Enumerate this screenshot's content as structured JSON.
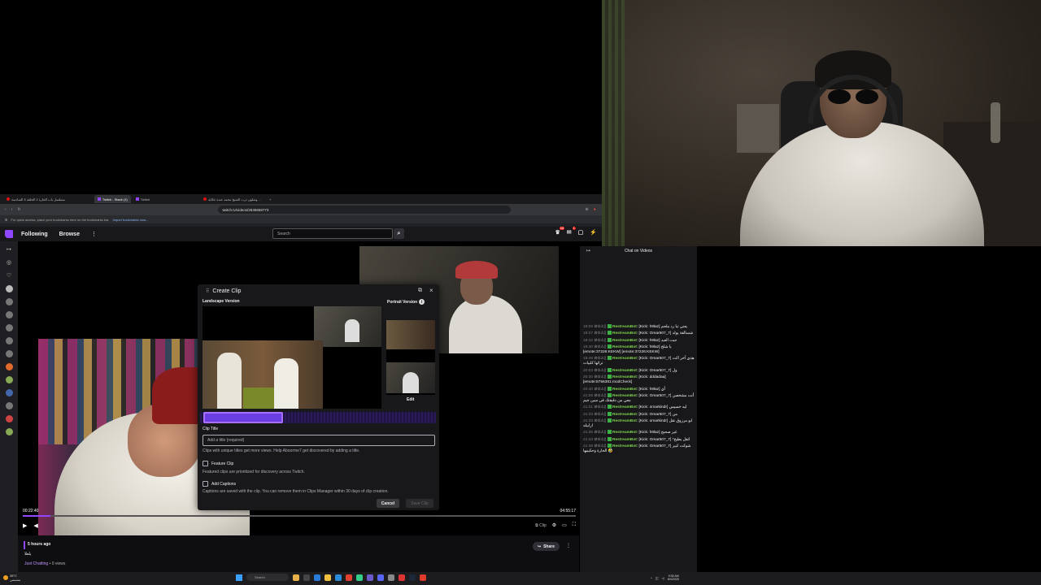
{
  "browser": {
    "tabs": [
      {
        "label": "مسلسل باب الحارة 2 الحلقة 5 السادسة",
        "active": false
      },
      {
        "label": "Twitch - Stack (1)",
        "active": true
      },
      {
        "label": "Twitch",
        "active": false
      },
      {
        "label": "وشلون ذرب الشيخ محمد عندة حكاية ...",
        "active": false
      }
    ],
    "url": "twitch.tv/videos/2836668773",
    "bookmarks_hint": "For quick access, place your bookmarks here on the bookmarks bar.",
    "bookmarks_link": "Import bookmarks now..."
  },
  "topnav": {
    "following": "Following",
    "browse": "Browse",
    "more": "⋮",
    "search_placeholder": "Search",
    "notif_count_1": "13",
    "notif_count_2": "1"
  },
  "player": {
    "time_current": "00:22:40",
    "time_total": "04:55:17",
    "progress": 0.05,
    "clip_label": "Clip"
  },
  "clip_dialog": {
    "title": "Create Clip",
    "landscape_label": "Landscape Version",
    "portrait_label": "Portrait Version",
    "edit_label": "Edit",
    "clip_title_label": "Clip Title",
    "clip_title_placeholder": "Add a title (required)",
    "clip_title_help": "Clips with unique titles get more views. Help Aboorme7 get discovered by adding a title.",
    "feature_label": "Feature Clip",
    "feature_help": "Featured clips are prioritized for discovery across Twitch.",
    "captions_label": "Add Captions",
    "captions_help": "Captions are saved with the clip. You can remove them in Clips Manager within 30 days of clip creation.",
    "cancel_label": "Cancel",
    "save_label": "Save Clip"
  },
  "video_info": {
    "ago": "5 hours ago",
    "title": "يلعلا",
    "category": "Just Chatting",
    "views": " • 0 views",
    "share_label": "Share"
  },
  "chat": {
    "header": "Chat on Videos",
    "messages": [
      {
        "ts": "18:08",
        "user": "RestreamBot",
        "text": ": [Kick: h9laz] يعني تبا رد ملحم"
      },
      {
        "ts": "18:27",
        "user": "RestreamBot",
        "text": ": [Kick: Omar507_7] شسالفة يولد"
      },
      {
        "ts": "18:32",
        "user": "RestreamBot",
        "text": ": [Kick: h9laz] جبت العبد"
      },
      {
        "ts": "18:40",
        "user": "RestreamBot",
        "text": ": [Kick: h9laz] يا شلخ [emote:37226:KEKW] [emote:37226:KEKW]"
      },
      {
        "ts": "19:48",
        "user": "RestreamBot",
        "text": ": [Kick: Omar507_7] هذي آخر اكت تراثها كلبيات"
      },
      {
        "ts": "20:03",
        "user": "RestreamBot",
        "text": ": [Kick: Omar507_7] ول"
      },
      {
        "ts": "20:30",
        "user": "RestreamBot",
        "text": ": [Kick: dddadaa] [emote:5756381:modCheck]"
      },
      {
        "ts": "20:40",
        "user": "RestreamBot",
        "text": ": [Kick: h9laz] أي"
      },
      {
        "ts": "21:06",
        "user": "RestreamBot",
        "text": ": [Kick: Omar507_7] أنت مشخصن معي من دقيقتك في سين جيم"
      },
      {
        "ts": "21:31",
        "user": "RestreamBot",
        "text": ": [Kick: omarkindr] ليه خسيس"
      },
      {
        "ts": "21:33",
        "user": "RestreamBot",
        "text": ": [Kick: Omar507_7] من"
      },
      {
        "ts": "21:33",
        "user": "RestreamBot",
        "text": ": [Kick: omarkindr] ابو مرزوق تقل ارابيله"
      },
      {
        "ts": "21:36",
        "user": "RestreamBot",
        "text": ": [Kick: h9laz] غير صحيح"
      },
      {
        "ts": "21:43",
        "user": "RestreamBot",
        "text": ": [Kick: Omar507_7] *اتقل يطيخ"
      },
      {
        "ts": "21:48",
        "user": "RestreamBot",
        "text": ": [Kick: Omar507_7] شوكت كبير الحارة وحكيمها 🤣"
      }
    ]
  },
  "taskbar": {
    "weather": "38°C",
    "weather_sub": "مشمس",
    "search_label": "Search",
    "time": "9:38 AM",
    "date": "8/4/2025"
  },
  "colors": {
    "twitch_purple": "#9146ff",
    "bot_green": "#7fd34c",
    "live_red": "#e91916"
  }
}
